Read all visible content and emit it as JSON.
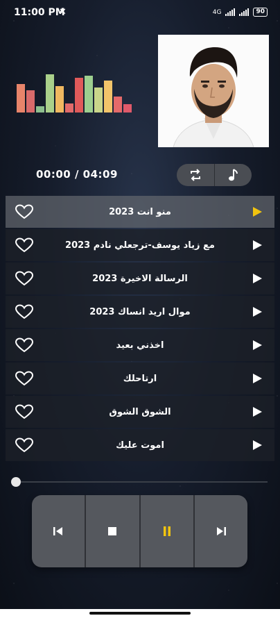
{
  "status_bar": {
    "time": "11:00 PM",
    "dnd_icon": "✕",
    "network": "4G",
    "battery": "90"
  },
  "equalizer": {
    "levels": [
      0.7,
      0.55,
      0.15,
      0.95,
      0.65,
      0.22,
      0.87,
      0.92,
      0.62,
      0.8,
      0.4,
      0.2
    ],
    "colors": [
      "#e8846a",
      "#d96a6a",
      "#8ebf8e",
      "#aad08a",
      "#f0b860",
      "#e26a6a",
      "#e05a5a",
      "#9dcf8f",
      "#c9d68a",
      "#f2c46a",
      "#e46a6a",
      "#e05a6a"
    ]
  },
  "now_playing": {
    "time_display": "00:00 / 04:09",
    "progress": 0
  },
  "player_buttons": {
    "repeat_icon": "repeat-icon",
    "music_note_icon": "music-note-icon"
  },
  "playlist": [
    {
      "title": "منو انت 2023",
      "active": true
    },
    {
      "title": "مع زياد يوسف-ترجعلي نادم 2023",
      "active": false
    },
    {
      "title": "الرسالة الاخيرة 2023",
      "active": false
    },
    {
      "title": "موال اريد انساك 2023",
      "active": false
    },
    {
      "title": "اخذني بعيد",
      "active": false
    },
    {
      "title": "ارتاحلك",
      "active": false
    },
    {
      "title": "الشوق الشوق",
      "active": false
    },
    {
      "title": "اموت عليك",
      "active": false
    }
  ],
  "transport": {
    "icons": [
      "previous-icon",
      "stop-icon",
      "pause-icon",
      "next-icon"
    ],
    "accent": "#f1c40f"
  },
  "colors": {
    "accent": "#f1c40f",
    "row_bg": "#1c2028",
    "active_row_bg": "#62666e"
  }
}
